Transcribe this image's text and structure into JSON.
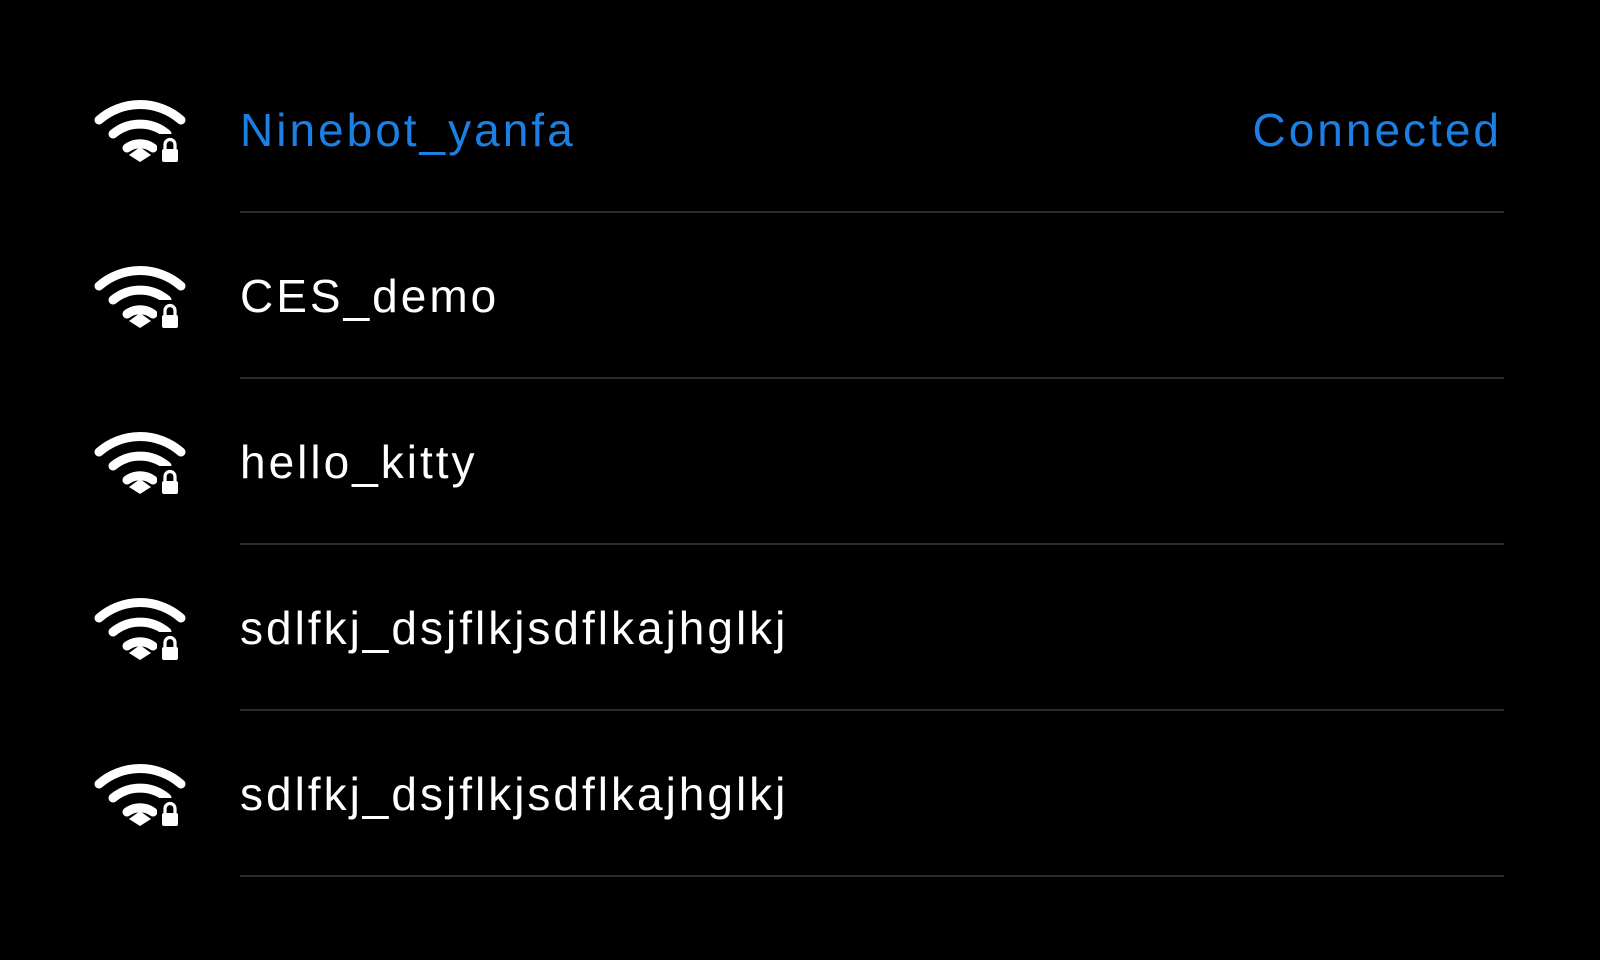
{
  "colors": {
    "background": "#000000",
    "text": "#ffffff",
    "accent": "#1b7fe3",
    "divider": "#2a2a2a"
  },
  "networks": [
    {
      "name": "Ninebot_yanfa",
      "status": "Connected",
      "connected": true,
      "secured": true,
      "icon": "wifi-lock-icon"
    },
    {
      "name": "CES_demo",
      "status": "",
      "connected": false,
      "secured": true,
      "icon": "wifi-lock-icon"
    },
    {
      "name": "hello_kitty",
      "status": "",
      "connected": false,
      "secured": true,
      "icon": "wifi-lock-icon"
    },
    {
      "name": "sdlfkj_dsjflkjsdflkajhglkj",
      "status": "",
      "connected": false,
      "secured": true,
      "icon": "wifi-lock-icon"
    },
    {
      "name": "sdlfkj_dsjflkjsdflkajhglkj",
      "status": "",
      "connected": false,
      "secured": true,
      "icon": "wifi-lock-icon"
    }
  ]
}
